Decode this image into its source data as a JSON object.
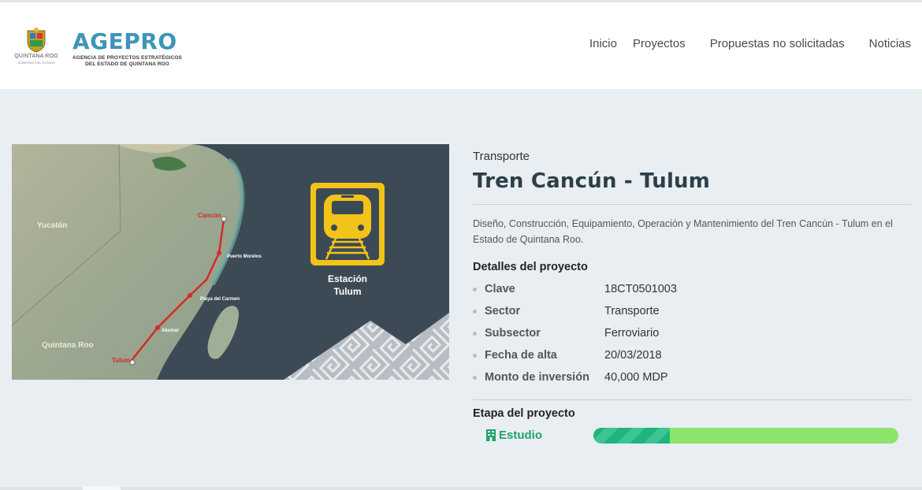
{
  "header": {
    "seal_label": "QUINTANA ROO",
    "seal_sublabel": "GOBIERNO DEL ESTADO",
    "brand": "AGEPRO",
    "brand_sub_line1": "AGENCIA DE PROYECTOS ESTRATÉGICOS",
    "brand_sub_line2": "DEL ESTADO DE QUINTANA ROO"
  },
  "nav": {
    "items": [
      "Inicio",
      "Proyectos",
      "Propuestas no solicitadas",
      "Noticias"
    ]
  },
  "map": {
    "regions": [
      "Yucatán",
      "Quintana Roo"
    ],
    "stops": [
      "Cancún",
      "Puerto Morelos",
      "Playa del Carmen",
      "Akumal",
      "Tulum"
    ],
    "station_line1": "Estación",
    "station_line2": "Tulum"
  },
  "project": {
    "category": "Transporte",
    "title": "Tren Cancún - Tulum",
    "description": "Diseño, Construcción, Equipamiento, Operación y Mantenimiento del Tren Cancún - Tulum en el Estado de Quintana Roo.",
    "details_heading": "Detalles del proyecto",
    "details": [
      {
        "key": "Clave",
        "value": "18CT0501003"
      },
      {
        "key": "Sector",
        "value": "Transporte"
      },
      {
        "key": "Subsector",
        "value": "Ferroviario"
      },
      {
        "key": "Fecha de alta",
        "value": "20/03/2018"
      },
      {
        "key": "Monto de inversión",
        "value": "40,000 MDP"
      }
    ],
    "stage_heading": "Etapa del proyecto",
    "stage_label": "Estudio",
    "stage_progress": 0.25
  },
  "colors": {
    "brand": "#3d95b8",
    "stage_text": "#22a36a",
    "progress_track": "#8ce46a",
    "progress_fill": "#1fb37f",
    "route": "#d42a2a",
    "train_sign": "#f2c318"
  }
}
